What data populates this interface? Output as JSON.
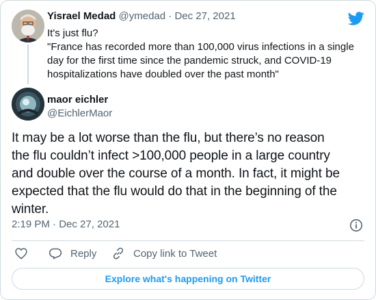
{
  "parent_tweet": {
    "author_name": "Yisrael Medad",
    "handle": "@ymedad",
    "separator": "·",
    "date": "Dec 27, 2021",
    "lines": [
      "It's just flu?",
      "\"France has recorded more than 100,000 virus infections in a single",
      "day for the first time since the pandemic struck, and COVID-19",
      "hospitalizations have doubled over the past month\""
    ]
  },
  "main_tweet": {
    "author_name": "maor eichler",
    "handle": "@EichlerMaor",
    "lines": [
      "It may be a lot worse than the flu, but there’s no reason",
      "the flu couldn’t infect >100,000 people in a large country",
      "and double over the course of a month. In fact, it might be",
      "expected that the flu would do that in the beginning of the",
      "winter."
    ],
    "time": "2:19 PM",
    "separator": "·",
    "date": "Dec 27, 2021"
  },
  "actions": {
    "reply_label": "Reply",
    "copy_label": "Copy link to Tweet"
  },
  "explore_label": "Explore what's happening on Twitter",
  "colors": {
    "brand": "#1d9bf0",
    "secondary_text": "#536471",
    "border": "#cfd9de"
  },
  "icons": [
    "twitter-bird-icon",
    "info-icon",
    "heart-icon",
    "reply-icon",
    "link-icon"
  ]
}
